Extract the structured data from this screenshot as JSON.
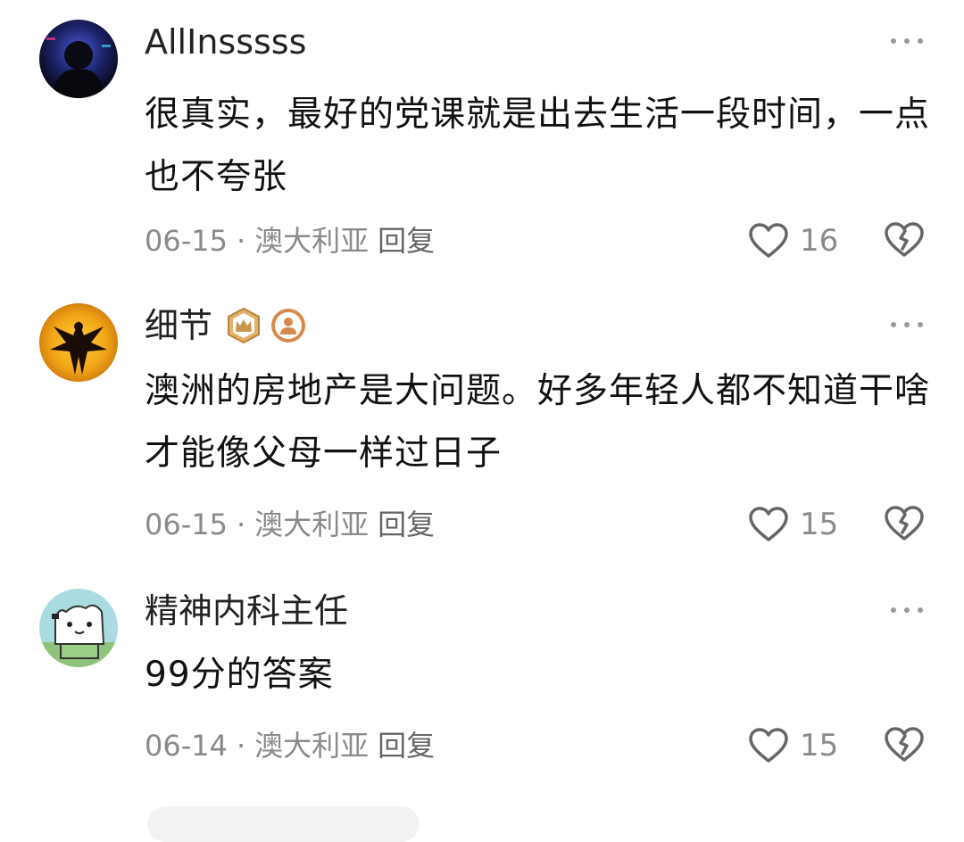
{
  "comments": [
    {
      "username": "AllInsssss",
      "text": "很真实，最好的党课就是出去生活一段时间，一点也不夸张",
      "date": "06-15",
      "location": "澳大利亚",
      "reply_label": "回复",
      "likes": "16",
      "avatar_icon": "dark-figure-avatar",
      "badges": []
    },
    {
      "username": "细节",
      "text": "澳洲的房地产是大问题。好多年轻人都不知道干啥才能像父母一样过日子",
      "date": "06-15",
      "location": "澳大利亚",
      "reply_label": "回复",
      "likes": "15",
      "avatar_icon": "phoenix-avatar",
      "badges": [
        "crown-badge-icon",
        "user-badge-icon"
      ]
    },
    {
      "username": "精神内科主任",
      "text": "99分的答案",
      "date": "06-14",
      "location": "澳大利亚",
      "reply_label": "回复",
      "likes": "15",
      "avatar_icon": "cartoon-cat-avatar",
      "badges": []
    }
  ],
  "separator": "·",
  "icons": {
    "more": "more-options-icon",
    "like": "heart-icon",
    "dislike": "broken-heart-icon"
  },
  "colors": {
    "text": "#111111",
    "meta": "#8a8a8a",
    "icon": "#666666",
    "badge_gold": "#c9974a",
    "badge_orange": "#e08a3c"
  }
}
